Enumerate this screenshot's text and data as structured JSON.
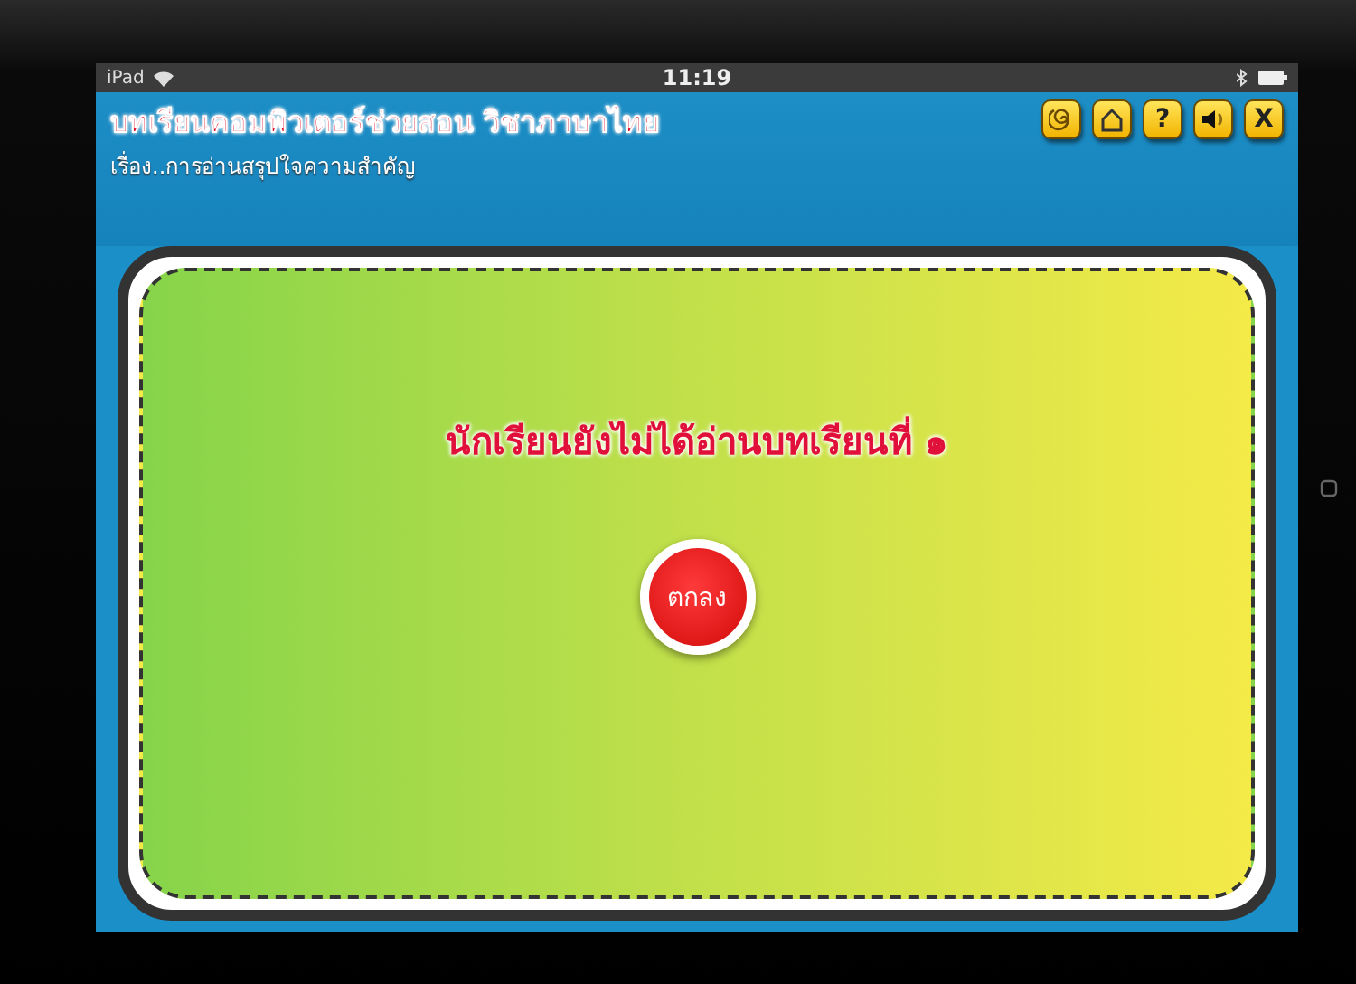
{
  "status_bar": {
    "device": "iPad",
    "time": "11:19"
  },
  "header": {
    "title": "บทเรียนคอมพิวเตอร์ช่วยสอน วิชาภาษาไทย",
    "subtitle": "เรื่อง..การอ่านสรุปใจความสำคัญ"
  },
  "toolbar": [
    {
      "kind": "replay"
    },
    {
      "kind": "home"
    },
    {
      "kind": "text",
      "label": "?"
    },
    {
      "kind": "sound"
    },
    {
      "kind": "text",
      "label": "X"
    }
  ],
  "dialog": {
    "message": "นักเรียนยังไม่ได้อ่านบทเรียนที่ ๑",
    "button": "ตกลง"
  }
}
